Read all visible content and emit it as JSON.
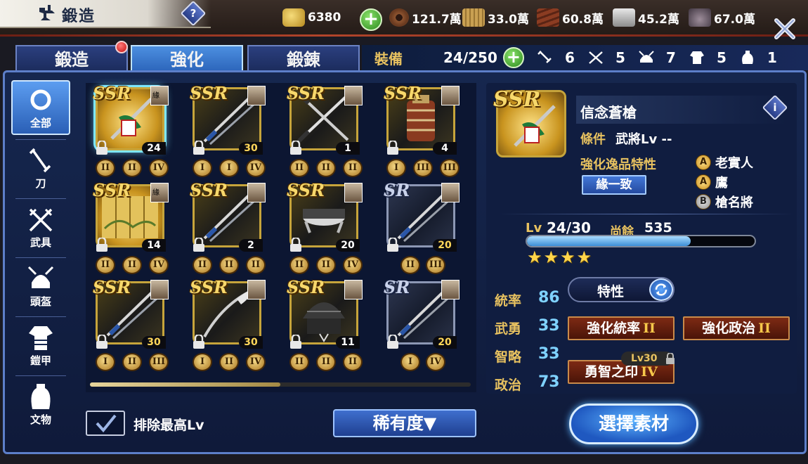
{
  "header": {
    "title": "鍛造",
    "help_symbol": "?",
    "resources": [
      {
        "icon": "koban-coin-icon",
        "value": "6380"
      },
      {
        "icon": "mon-coin-icon",
        "value": "121.7萬"
      },
      {
        "icon": "rice-bale-icon",
        "value": "33.0萬"
      },
      {
        "icon": "lumber-icon",
        "value": "60.8萬"
      },
      {
        "icon": "iron-ingot-icon",
        "value": "45.2萬"
      },
      {
        "icon": "ore-icon",
        "value": "67.0萬"
      }
    ],
    "plus_symbol": "+"
  },
  "tabs": [
    {
      "label": "鍛造",
      "active": false,
      "has_notification": true
    },
    {
      "label": "強化",
      "active": true,
      "has_notification": false
    },
    {
      "label": "鍛錬",
      "active": false,
      "has_notification": false
    }
  ],
  "equipment": {
    "label": "裝備",
    "count": "24/250",
    "plus_symbol": "+",
    "stats": [
      {
        "value": "6",
        "icon": "sword-icon"
      },
      {
        "value": "5",
        "icon": "weapon-cross-icon"
      },
      {
        "value": "7",
        "icon": "helmet-icon"
      },
      {
        "value": "5",
        "icon": "armor-icon"
      },
      {
        "value": "1",
        "icon": "vase-icon"
      }
    ]
  },
  "categories": [
    {
      "label": "全部",
      "icon": "all-circle-icon",
      "active": true
    },
    {
      "label": "刀",
      "icon": "sword-icon",
      "active": false
    },
    {
      "label": "武具",
      "icon": "weapon-cross-icon",
      "active": false
    },
    {
      "label": "頭盔",
      "icon": "helmet-icon",
      "active": false
    },
    {
      "label": "鎧甲",
      "icon": "armor-icon",
      "active": false
    },
    {
      "label": "文物",
      "icon": "vase-icon",
      "active": false
    }
  ],
  "items": [
    {
      "rarity": "SSR",
      "level": "24",
      "lv_color": "w",
      "slots": [
        "II",
        "II",
        "IV"
      ],
      "art": "ornament",
      "bond": "緣",
      "selected": true
    },
    {
      "rarity": "SSR",
      "level": "30",
      "lv_color": "y",
      "slots": [
        "I",
        "I",
        "IV"
      ],
      "art": "spear",
      "bond": "",
      "selected": false
    },
    {
      "rarity": "SSR",
      "level": "1",
      "lv_color": "w",
      "slots": [
        "II",
        "II",
        "II"
      ],
      "art": "swords",
      "bond": "",
      "selected": false
    },
    {
      "rarity": "SSR",
      "level": "4",
      "lv_color": "w",
      "slots": [
        "I",
        "III",
        "III"
      ],
      "art": "armor",
      "bond": "",
      "selected": false
    },
    {
      "rarity": "SSR",
      "level": "14",
      "lv_color": "w",
      "slots": [
        "II",
        "II",
        "IV"
      ],
      "art": "screen",
      "bond": "緣",
      "selected": false
    },
    {
      "rarity": "SSR",
      "level": "2",
      "lv_color": "w",
      "slots": [
        "II",
        "II",
        "II"
      ],
      "art": "spear",
      "bond": "",
      "selected": false
    },
    {
      "rarity": "SSR",
      "level": "20",
      "lv_color": "w",
      "slots": [
        "II",
        "II",
        "IV"
      ],
      "art": "helmet",
      "bond": "",
      "selected": false
    },
    {
      "rarity": "SR",
      "level": "20",
      "lv_color": "y",
      "slots": [
        "II",
        "III"
      ],
      "art": "spear",
      "bond": "",
      "selected": false
    },
    {
      "rarity": "SSR",
      "level": "30",
      "lv_color": "y",
      "slots": [
        "I",
        "II",
        "III"
      ],
      "art": "spear",
      "bond": "",
      "selected": false
    },
    {
      "rarity": "SSR",
      "level": "30",
      "lv_color": "y",
      "slots": [
        "I",
        "II",
        "IV"
      ],
      "art": "naginata",
      "bond": "",
      "selected": false
    },
    {
      "rarity": "SSR",
      "level": "11",
      "lv_color": "w",
      "slots": [
        "II",
        "II",
        "II"
      ],
      "art": "kabuto",
      "bond": "",
      "selected": false
    },
    {
      "rarity": "SR",
      "level": "20",
      "lv_color": "y",
      "slots": [
        "I",
        "IV"
      ],
      "art": "spear",
      "bond": "",
      "selected": false
    }
  ],
  "list_controls": {
    "exclude_label": "排除最高Lv",
    "exclude_checked": true,
    "sort_label": "稀有度▼",
    "scroll_position": 0.5
  },
  "detail": {
    "rarity": "SSR",
    "name": "信念蒼槍",
    "info_symbol": "i",
    "condition_label": "條件",
    "condition_value": "武將Lv --",
    "trait_label": "強化逸品特性",
    "bond_button": "緣一致",
    "skills": [
      {
        "grade": "A",
        "name": "老實人"
      },
      {
        "grade": "A",
        "name": "鷹"
      },
      {
        "grade": "B",
        "name": "槍名將"
      }
    ],
    "level_label": "Lv",
    "level_value": "24/30",
    "remaining_label": "尚餘",
    "remaining_value": "535",
    "xp_fraction": 0.72,
    "stars": "★★★★",
    "trait_toggle": "特性",
    "stats": [
      {
        "name": "統率",
        "value": "86"
      },
      {
        "name": "武勇",
        "value": "33"
      },
      {
        "name": "智略",
        "value": "33"
      },
      {
        "name": "政治",
        "value": "73"
      }
    ],
    "enhancements": [
      {
        "label": "強化統率",
        "grade": "II"
      },
      {
        "label": "強化政治",
        "grade": "II"
      },
      {
        "label": "勇智之印",
        "grade": "IV"
      }
    ],
    "lock_level": "Lv30"
  },
  "select_button": "選擇素材",
  "colors": {
    "accent_gold": "#e8c260",
    "stat_blue": "#7fd2ff",
    "panel_border": "#5d7fc9"
  }
}
